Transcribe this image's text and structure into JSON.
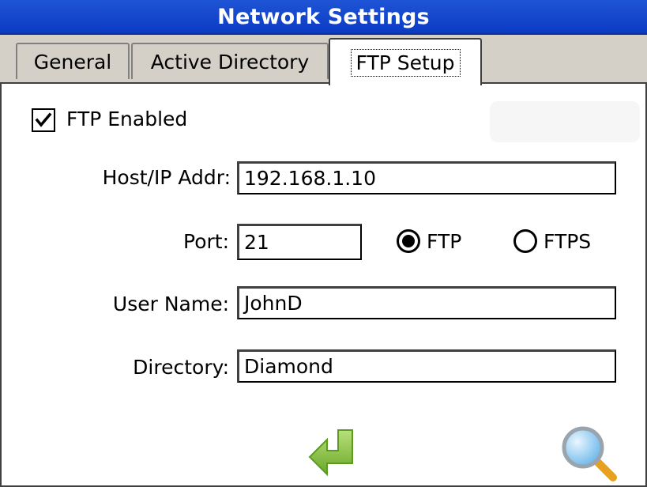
{
  "window": {
    "title": "Network Settings"
  },
  "tabs": [
    {
      "label": "General",
      "active": false
    },
    {
      "label": "Active Directory",
      "active": false
    },
    {
      "label": "FTP Setup",
      "active": true
    }
  ],
  "form": {
    "ftp_enabled": {
      "label": "FTP Enabled",
      "checked": true
    },
    "host": {
      "label": "Host/IP Addr:",
      "value": "192.168.1.10"
    },
    "port": {
      "label": "Port:",
      "value": "21"
    },
    "protocol": {
      "options": [
        {
          "label": "FTP",
          "selected": true
        },
        {
          "label": "FTPS",
          "selected": false
        }
      ]
    },
    "user": {
      "label": "User Name:",
      "value": "JohnD"
    },
    "directory": {
      "label": "Directory:",
      "value": "Diamond"
    }
  },
  "footer": {
    "enter_icon": "enter-arrow-icon",
    "search_icon": "magnifier-icon"
  },
  "colors": {
    "title_bar": "#0b3bc4",
    "tab_strip": "#d4d0c8",
    "enter_arrow": "#8dc63f",
    "magnifier_lens": "#7ec4f0",
    "magnifier_handle": "#e8a020"
  }
}
